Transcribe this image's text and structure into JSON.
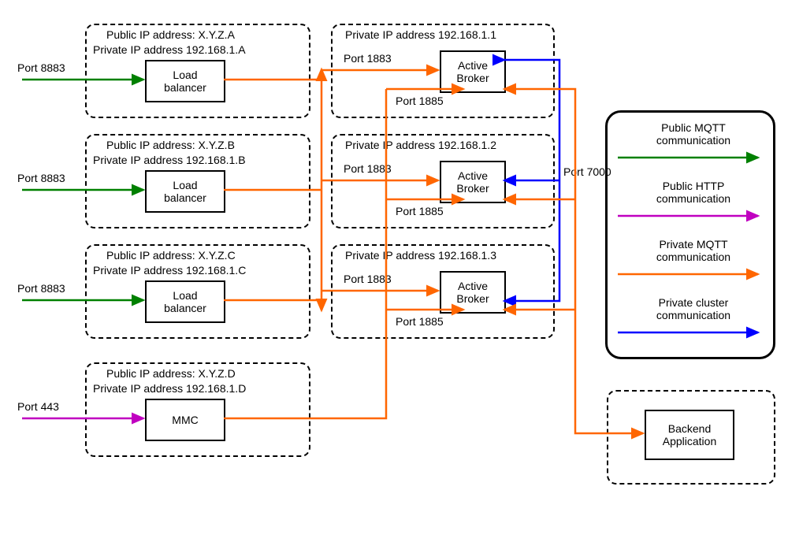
{
  "lb": {
    "a": {
      "public": "Public IP address: X.Y.Z.A",
      "private": "Private IP address 192.168.1.A",
      "box": "Load balancer",
      "port": "Port 8883"
    },
    "b": {
      "public": "Public IP address: X.Y.Z.B",
      "private": "Private IP address 192.168.1.B",
      "box": "Load balancer",
      "port": "Port 8883"
    },
    "c": {
      "public": "Public IP address: X.Y.Z.C",
      "private": "Private IP address 192.168.1.C",
      "box": "Load balancer",
      "port": "Port 8883"
    },
    "d": {
      "public": "Public IP address: X.Y.Z.D",
      "private": "Private IP address 192.168.1.D",
      "box": "MMC",
      "port": "Port 443"
    }
  },
  "broker": {
    "a": {
      "private": "Private IP address 192.168.1.1",
      "box": "Active Broker",
      "p1": "Port 1883",
      "p2": "Port 1885"
    },
    "b": {
      "private": "Private IP address 192.168.1.2",
      "box": "Active Broker",
      "p1": "Port 1883",
      "p2": "Port 1885"
    },
    "c": {
      "private": "Private IP address 192.168.1.3",
      "box": "Active Broker",
      "p1": "Port 1883",
      "p2": "Port 1885"
    }
  },
  "cluster_port": "Port 7000",
  "backend": "Backend Application",
  "legend": {
    "mqtt_pub": "Public MQTT communication",
    "http_pub": "Public HTTP communication",
    "mqtt_priv": "Private MQTT communication",
    "cluster_priv": "Private cluster communication"
  },
  "colors": {
    "green": "#008000",
    "magenta": "#c000c0",
    "orange": "#ff6600",
    "blue": "#0000ff"
  }
}
